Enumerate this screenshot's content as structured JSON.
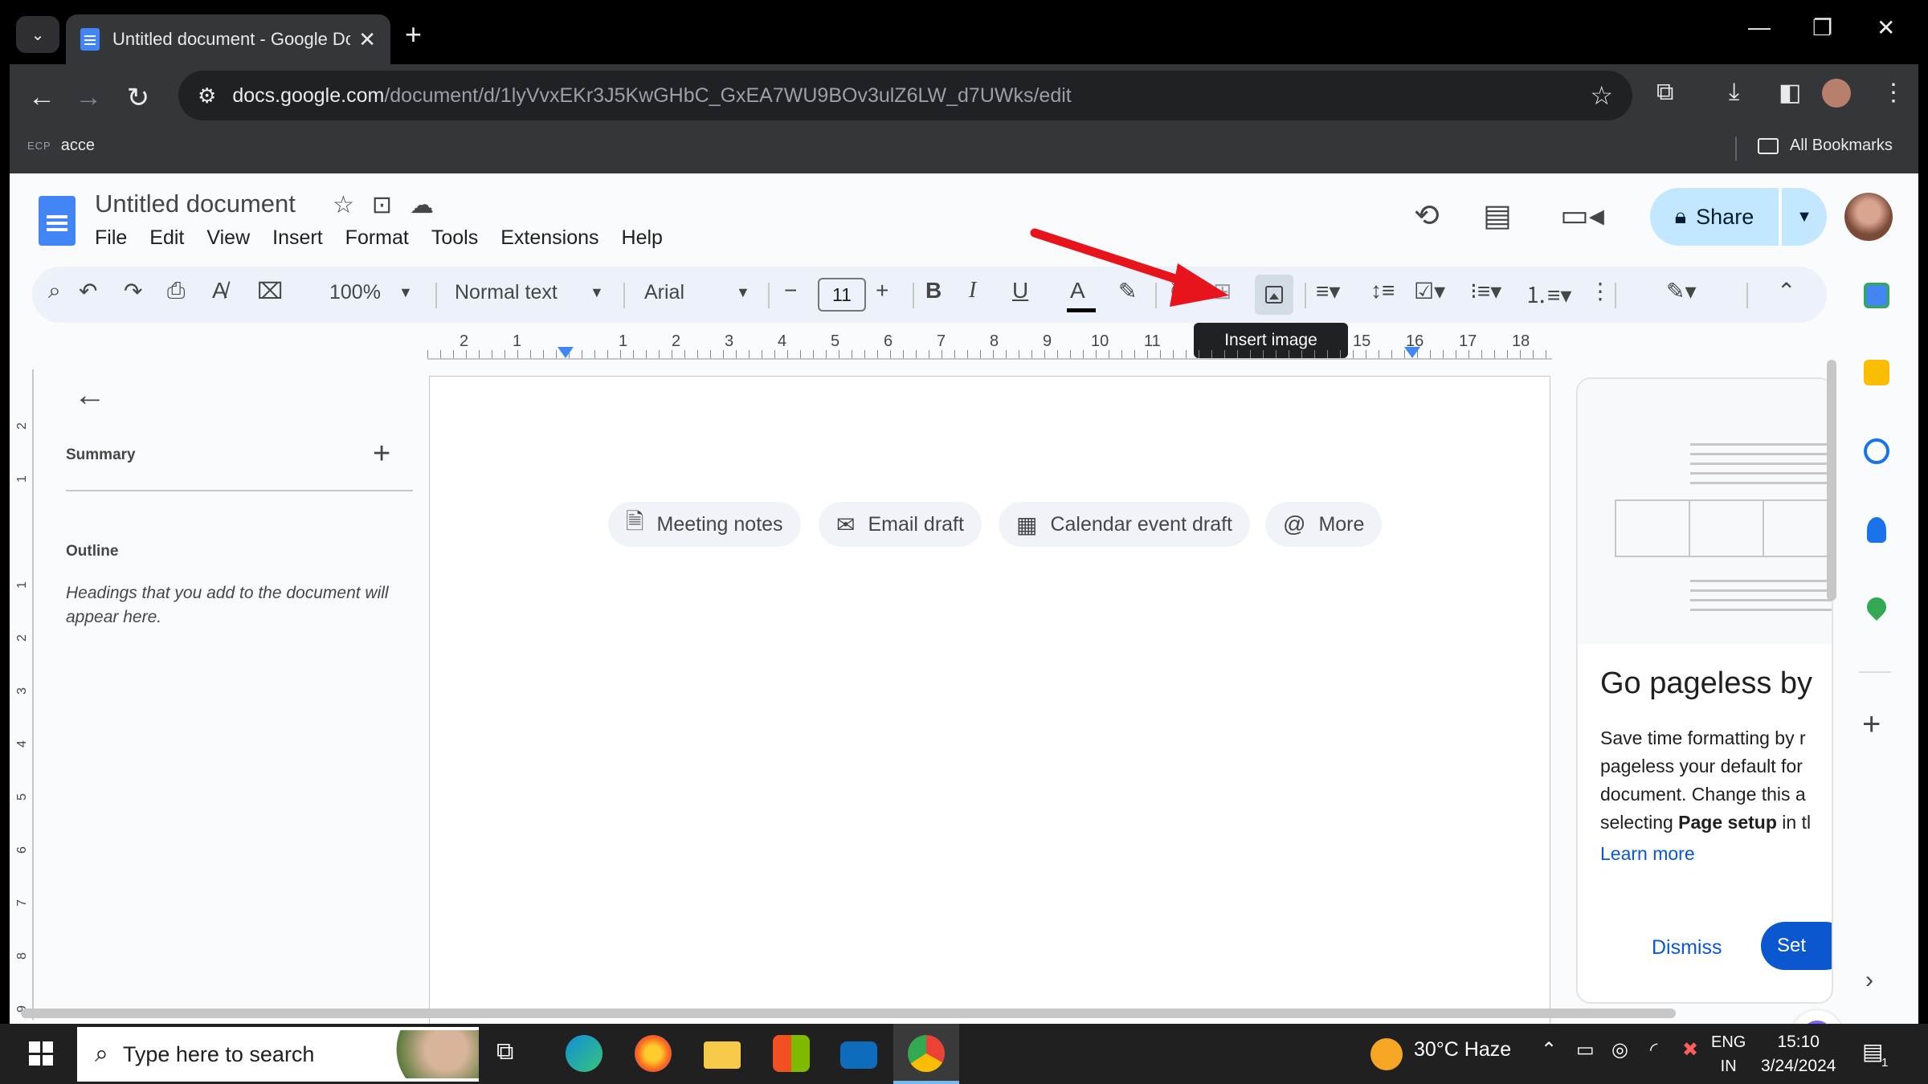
{
  "browser": {
    "tab_title": "Untitled document - Google Dc",
    "url_host": "docs.google.com",
    "url_path": "/document/d/1lyVvxEKr3J5KwGHbC_GxEA7WU9BOv3ulZ6LW_d7UWks/edit",
    "bookmark_prefix": "ECP",
    "bookmark_acce": "acce",
    "all_bookmarks": "All Bookmarks"
  },
  "docs": {
    "title": "Untitled document",
    "menu": [
      "File",
      "Edit",
      "View",
      "Insert",
      "Format",
      "Tools",
      "Extensions",
      "Help"
    ],
    "share_label": "Share"
  },
  "toolbar": {
    "zoom": "100%",
    "style": "Normal text",
    "font": "Arial",
    "font_size": "11",
    "tooltip": "Insert image"
  },
  "ruler": {
    "marks": [
      "2",
      "1",
      "1",
      "2",
      "3",
      "4",
      "5",
      "6",
      "7",
      "8",
      "9",
      "10",
      "11",
      "15",
      "16",
      "17",
      "18"
    ]
  },
  "outline_panel": {
    "summary": "Summary",
    "outline": "Outline",
    "hint": "Headings that you add to the document will appear here."
  },
  "chips": [
    "Meeting notes",
    "Email draft",
    "Calendar event draft",
    "More"
  ],
  "promo": {
    "title": "Go pageless by",
    "line1": "Save time formatting by r",
    "line2": "pageless your default for",
    "line3": "document. Change this a",
    "line4_pre": "selecting ",
    "line4_bold": "Page setup",
    "line4_post": " in tl",
    "learn_more": "Learn more",
    "dismiss": "Dismiss",
    "set": "Set"
  },
  "taskbar": {
    "search_placeholder": "Type here to search",
    "weather": "30°C  Haze",
    "lang1": "ENG",
    "lang2": "IN",
    "time": "15:10",
    "date": "3/24/2024",
    "notif_count": "1"
  },
  "colors": {
    "accent": "#0b57d0",
    "share_bg": "#c2e7ff",
    "annotation_arrow": "#e8141b"
  }
}
